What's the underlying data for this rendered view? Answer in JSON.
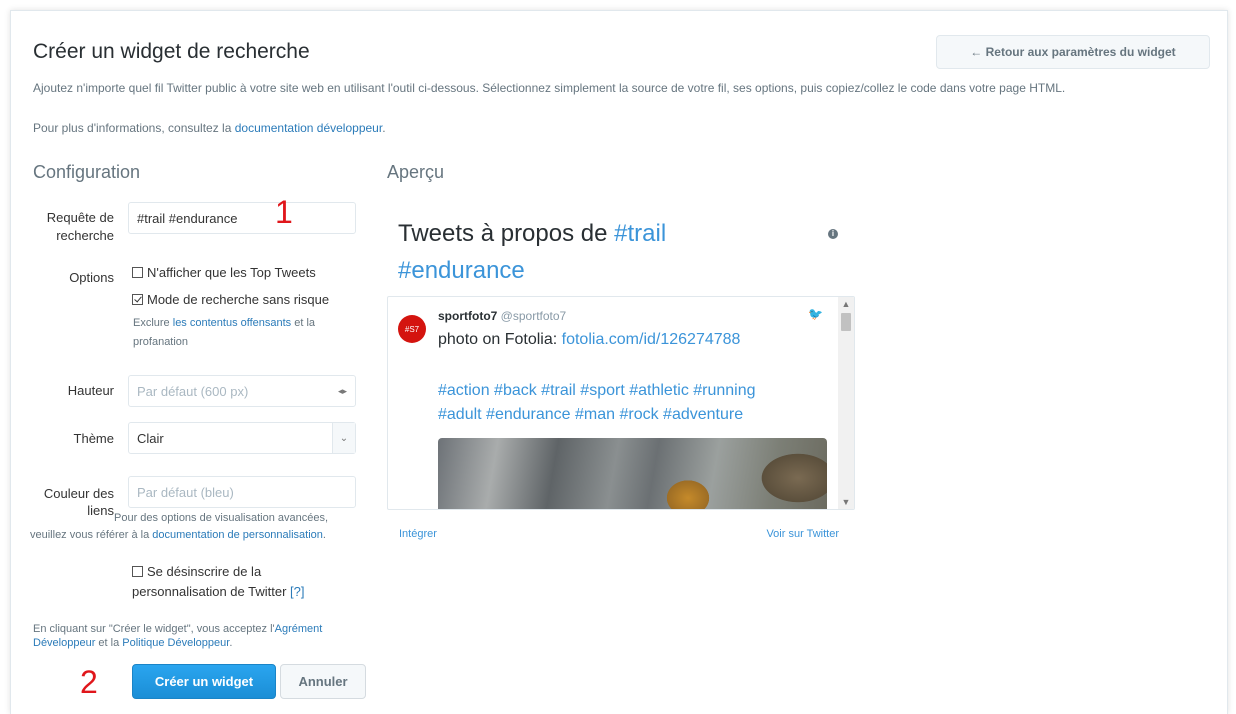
{
  "header": {
    "title": "Créer un widget de recherche",
    "back_button": "← Retour aux paramètres du widget"
  },
  "intro": {
    "line1": "Ajoutez n'importe quel fil Twitter public à votre site web en utilisant l'outil ci-dessous. Sélectionnez simplement la source de votre fil, ses options, puis copiez/collez le code dans votre page HTML.",
    "line2_prefix": "Pour plus d'informations, consultez la ",
    "line2_link": "documentation développeur",
    "line2_suffix": "."
  },
  "config": {
    "title": "Configuration",
    "query_label": "Requête de recherche",
    "query_value": "#trail #endurance",
    "options_label": "Options",
    "opt_top_tweets": "N'afficher que les Top Tweets",
    "opt_top_tweets_checked": false,
    "opt_safe": "Mode de recherche sans risque",
    "opt_safe_checked": true,
    "safe_help_prefix": "Exclure ",
    "safe_help_link": "les contentus offensants",
    "safe_help_suffix": " et la profanation",
    "height_label": "Hauteur",
    "height_placeholder": "Par défaut (600 px)",
    "theme_label": "Thème",
    "theme_value": "Clair",
    "link_color_label": "Couleur des liens",
    "link_color_placeholder": "Par défaut (bleu)",
    "advanced_prefix": "Pour des options de visualisation avancées, veuillez vous référer à la ",
    "advanced_link": "documentation de personnalisation",
    "advanced_suffix": ".",
    "opt_out_label": "Se désinscrire de la personnalisation de Twitter",
    "opt_out_help": "[?]",
    "opt_out_checked": false,
    "terms_prefix": "En cliquant sur \"Créer le widget\", vous acceptez l'",
    "terms_link1": "Agrément Développeur",
    "terms_mid": " et la ",
    "terms_link2": "Politique Développeur",
    "terms_suffix": ".",
    "create_button": "Créer un widget",
    "cancel_button": "Annuler"
  },
  "annotations": {
    "one": "1",
    "two": "2"
  },
  "preview": {
    "title": "Aperçu",
    "widget_title_prefix": "Tweets à propos de ",
    "widget_title_tag1": "#trail",
    "widget_title_tag2": "#endurance",
    "info_icon": "ℹ",
    "tweet": {
      "avatar_text": "#S7",
      "name": "sportfoto7",
      "handle": "@sportfoto7",
      "text_prefix": "photo on Fotolia: ",
      "text_link": "fotolia.com/id/126274788",
      "hashtags_line1": "#action #back #trail #sport #athletic #running",
      "hashtags_line2": "#adult #endurance #man #rock #adventure"
    },
    "embed_link": "Intégrer",
    "view_link": "Voir sur Twitter"
  },
  "colors": {
    "accent": "#2b7bb9",
    "primary_button": "#1da1f2",
    "annotation": "#e0161b"
  }
}
